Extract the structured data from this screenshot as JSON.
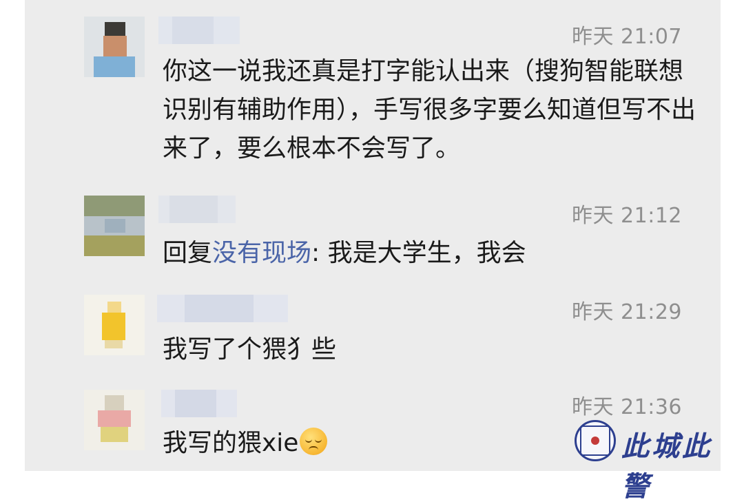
{
  "messages": [
    {
      "time": "昨天 21:07",
      "text": "你这一说我还真是打字能认出来（搜狗智能联想识别有辅助作用），手写很多字要么知道但写不出来了，要么根本不会写了。"
    },
    {
      "time": "昨天 21:12",
      "reply_prefix": "回复",
      "mention": "没有现场",
      "text": ": 我是大学生，我会"
    },
    {
      "time": "昨天 21:29",
      "text": "我写了个猥犭些"
    },
    {
      "time": "昨天 21:36",
      "text": "我写的猥xie",
      "emoji": "pensive-face-emoji"
    }
  ],
  "watermark": {
    "text": "此城此警",
    "seal_icon": "police-seal-icon",
    "color": "#2d3f8f"
  },
  "colors": {
    "background": "#ececec",
    "timestamp": "#8e8e8e",
    "mention": "#4a64a8",
    "text": "#1a1a1a"
  }
}
